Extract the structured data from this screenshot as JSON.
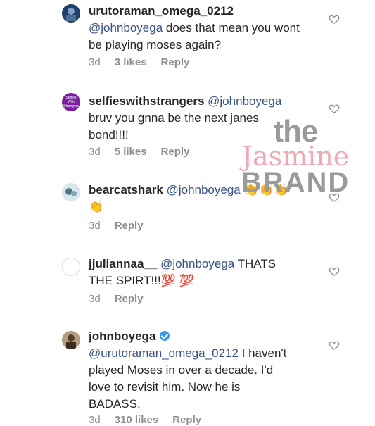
{
  "comments": [
    {
      "username": "urutoraman_omega_0212",
      "text_mention": "@johnboyega",
      "text": " does that mean you wont be playing moses again?",
      "time": "3d",
      "likes": "3 likes",
      "reply": "Reply"
    },
    {
      "username": "selfieswithstrangers",
      "avatar_text": "Selfies With Strangers",
      "text_mention": "@johnboyega",
      "text": " bruv you gnna be the next janes bond!!!!",
      "time": "3d",
      "likes": "5 likes",
      "reply": "Reply"
    },
    {
      "username": "bearcatshark",
      "text_mention": "@johnboyega",
      "text": " 👏👏👏👏",
      "time": "3d",
      "reply": "Reply"
    },
    {
      "username": "jjuliannaa__",
      "text_mention": "@johnboyega",
      "text": " THATS THE SPIRT!!!💯 💯",
      "time": "3d",
      "reply": "Reply"
    },
    {
      "username": "johnboyega",
      "text_mention": "@urutoraman_omega_0212",
      "text": " I haven't played Moses in over a decade. I'd love to revisit him. Now he is BADASS.",
      "time": "3d",
      "likes": "310 likes",
      "reply": "Reply"
    }
  ],
  "watermark": {
    "line1": "the",
    "line2": "Jasmine",
    "line3": "BRAND"
  },
  "colors": {
    "text": "#262626",
    "mention": "#385185",
    "meta": "#8e8e8e",
    "verified": "#3897f0",
    "watermark_pink": "#f2a7b5"
  }
}
